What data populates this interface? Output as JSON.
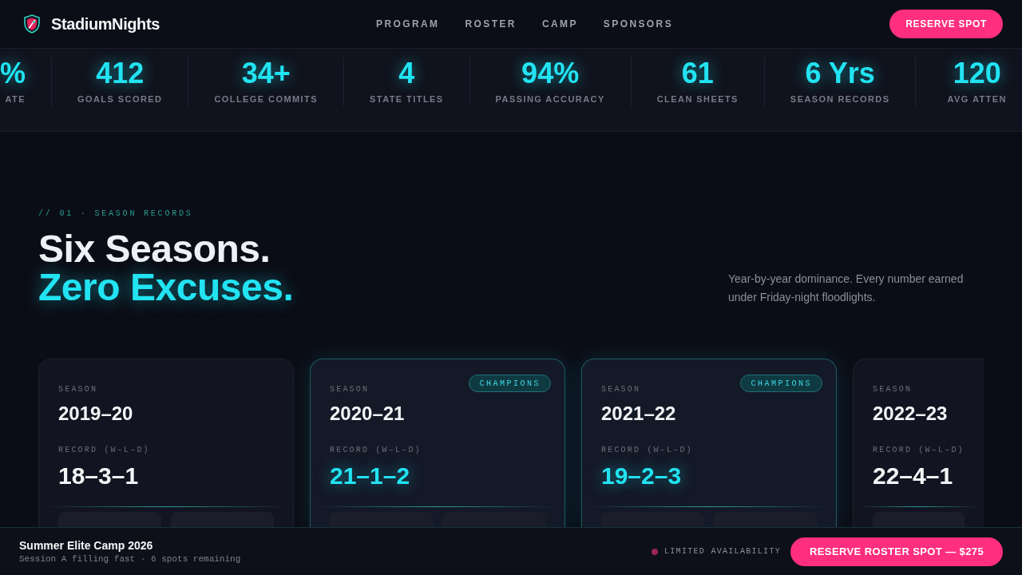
{
  "header": {
    "brand": "StadiumNights",
    "nav": [
      "PROGRAM",
      "ROSTER",
      "CAMP",
      "SPONSORS"
    ],
    "cta": "RESERVE SPOT"
  },
  "stats": [
    {
      "value": "%",
      "label": "ATE"
    },
    {
      "value": "412",
      "label": "GOALS SCORED"
    },
    {
      "value": "34+",
      "label": "COLLEGE COMMITS"
    },
    {
      "value": "4",
      "label": "STATE TITLES"
    },
    {
      "value": "94%",
      "label": "PASSING ACCURACY"
    },
    {
      "value": "61",
      "label": "CLEAN SHEETS"
    },
    {
      "value": "6 Yrs",
      "label": "SEASON RECORDS"
    },
    {
      "value": "120",
      "label": "AVG ATTEN"
    }
  ],
  "section": {
    "eyebrow": "// 01 · SEASON RECORDS",
    "title": "Six Seasons.",
    "title_accent": "Zero Excuses.",
    "description": "Year-by-year dominance. Every number earned under Friday-night floodlights."
  },
  "seasons": [
    {
      "season_label": "SEASON",
      "season": "2019–20",
      "record_label": "RECORD (W–L–D)",
      "record": "18–3–1",
      "champions": false
    },
    {
      "season_label": "SEASON",
      "season": "2020–21",
      "record_label": "RECORD (W–L–D)",
      "record": "21–1–2",
      "champions": true,
      "badge": "CHAMPIONS"
    },
    {
      "season_label": "SEASON",
      "season": "2021–22",
      "record_label": "RECORD (W–L–D)",
      "record": "19–2–3",
      "champions": true,
      "badge": "CHAMPIONS"
    },
    {
      "season_label": "SEASON",
      "season": "2022–23",
      "record_label": "RECORD (W–L–D)",
      "record": "22–4–1",
      "champions": false
    }
  ],
  "bottom_bar": {
    "title": "Summer Elite Camp 2026",
    "subtitle": "Session A filling fast · 6 spots remaining",
    "availability": "LIMITED AVAILABILITY",
    "cta": "RESERVE ROSTER SPOT — $275"
  }
}
